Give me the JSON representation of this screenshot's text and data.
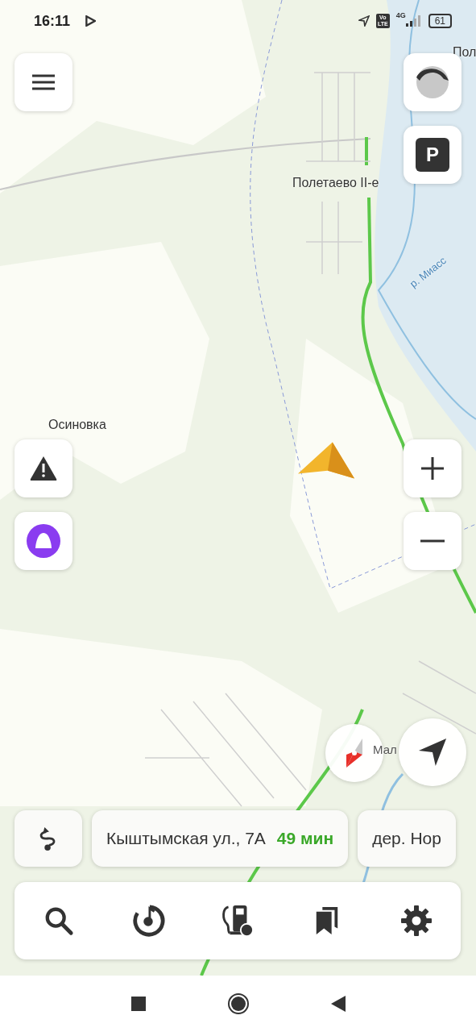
{
  "status_bar": {
    "time": "16:11",
    "volte_top": "Vo",
    "volte_bottom": "LTE",
    "network": "4G",
    "battery": "61"
  },
  "map": {
    "labels": [
      "Пол",
      "Полетаево II-е",
      "р. Миасс",
      "Осиновка",
      "Мал"
    ]
  },
  "destinations": [
    {
      "address": "Кыштымская ул., 7А",
      "eta": "49 мин"
    },
    {
      "address": "дер. Нор"
    }
  ],
  "toolbar": [
    {
      "kind": "search"
    },
    {
      "kind": "music"
    },
    {
      "kind": "fuel"
    },
    {
      "kind": "bookmarks"
    },
    {
      "kind": "settings"
    }
  ],
  "parking": {
    "label": "P"
  }
}
